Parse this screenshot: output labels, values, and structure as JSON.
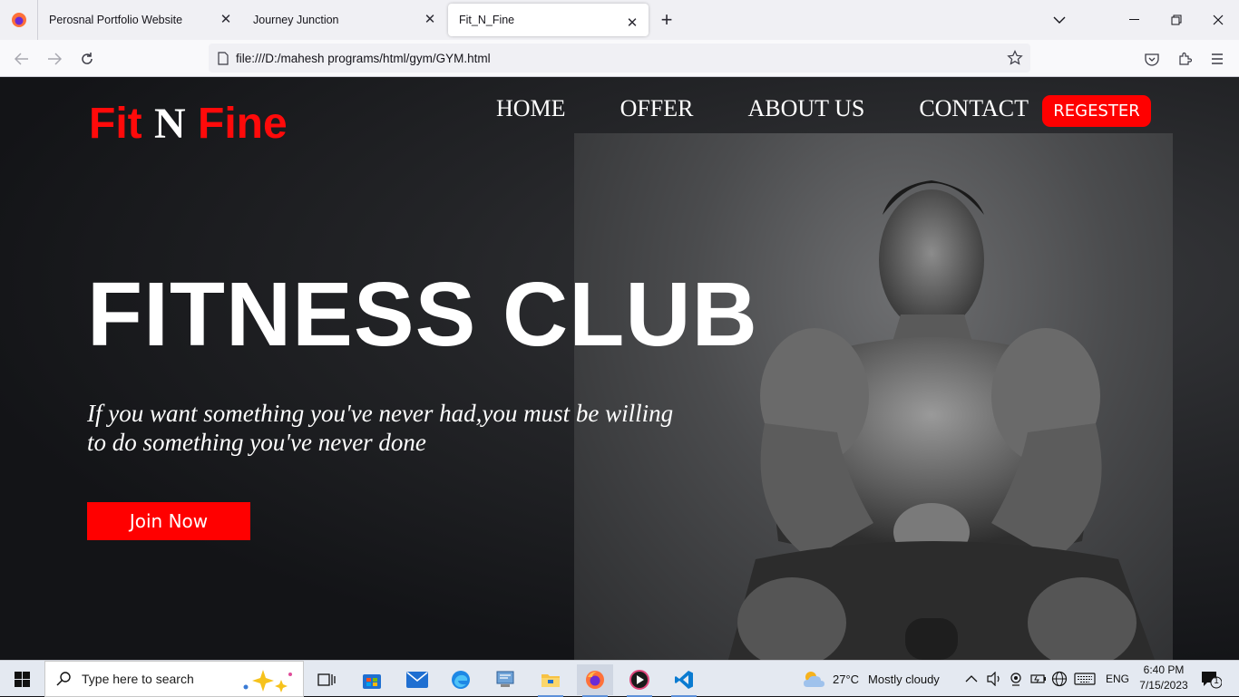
{
  "browser": {
    "tabs": [
      {
        "title": "Perosnal Portfolio Website"
      },
      {
        "title": "Journey Junction"
      },
      {
        "title": "Fit_N_Fine",
        "active": true
      }
    ],
    "url": "file:///D:/mahesh programs/html/gym/GYM.html"
  },
  "site": {
    "logo": {
      "part1": "Fit",
      "part2": "N",
      "part3": "Fine"
    },
    "nav": [
      "HOME",
      "OFFER",
      "ABOUT US",
      "CONTACT"
    ],
    "register_label": "REGESTER",
    "hero_title": "FITNESS CLUB",
    "hero_quote": "If you want something you've never had,you must be willing to do something you've never done",
    "join_label": "Join Now"
  },
  "taskbar": {
    "search_placeholder": "Type here to search",
    "weather_temp": "27°C",
    "weather_desc": "Mostly cloudy",
    "language": "ENG",
    "time": "6:40 PM",
    "date": "7/15/2023",
    "notification_count": "1"
  },
  "colors": {
    "brand_red": "#ff0a0a",
    "page_bg": "#131417"
  }
}
